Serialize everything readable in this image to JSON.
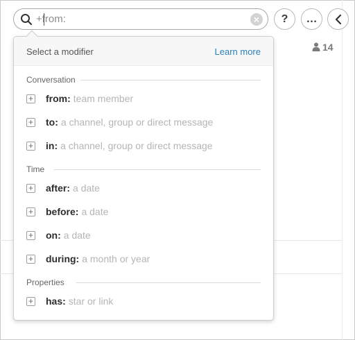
{
  "search": {
    "query": "+from:",
    "clear_icon": "clear-icon"
  },
  "header_buttons": {
    "help_label": "?",
    "more_label": "…",
    "back_icon": "chevron-left-icon"
  },
  "members": {
    "count": "14",
    "icon": "person-icon"
  },
  "dropdown": {
    "title": "Select a modifier",
    "learn_more": "Learn more",
    "sections": [
      {
        "label": "Conversation",
        "items": [
          {
            "key": "from:",
            "hint": "team member"
          },
          {
            "key": "to:",
            "hint": "a channel, group or direct message"
          },
          {
            "key": "in:",
            "hint": "a channel, group or direct message"
          }
        ]
      },
      {
        "label": "Time",
        "items": [
          {
            "key": "after:",
            "hint": "a date"
          },
          {
            "key": "before:",
            "hint": "a date"
          },
          {
            "key": "on:",
            "hint": "a date"
          },
          {
            "key": "during:",
            "hint": "a month or year"
          }
        ]
      },
      {
        "label": "Properties",
        "items": [
          {
            "key": "has:",
            "hint": "star or link"
          }
        ]
      }
    ]
  },
  "colors": {
    "link": "#2a80b9",
    "hint": "#b5b5b5",
    "header_bg": "#f7f7f7"
  }
}
